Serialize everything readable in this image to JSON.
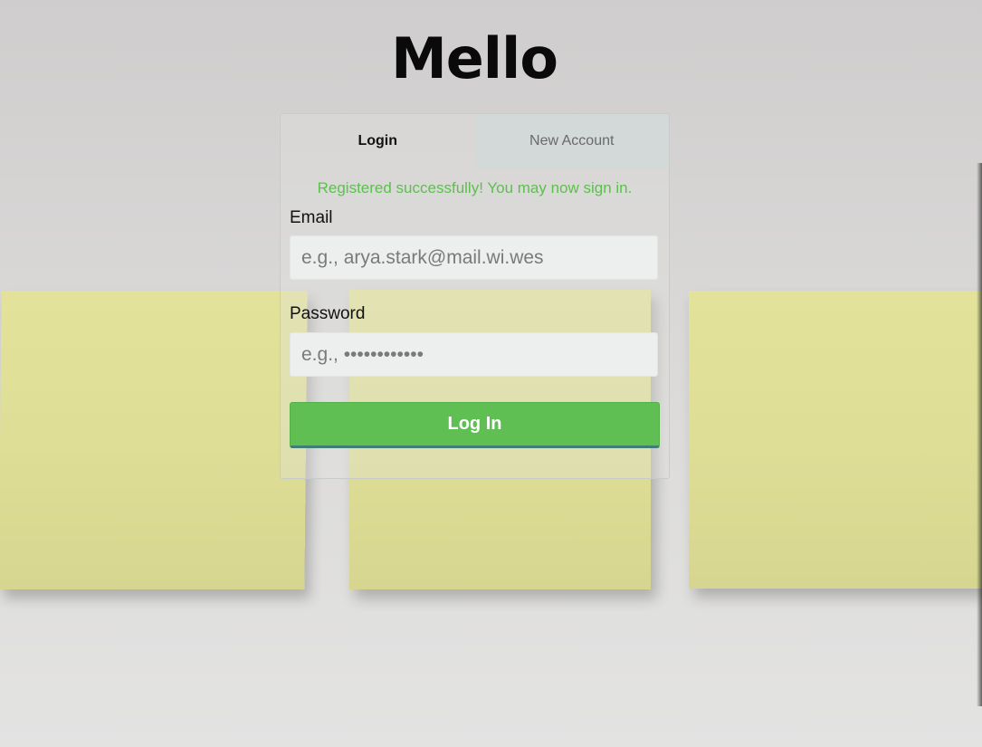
{
  "app": {
    "title": "Mello"
  },
  "tabs": [
    {
      "label": "Login",
      "active": true
    },
    {
      "label": "New Account",
      "active": false
    }
  ],
  "message": {
    "text": "Registered successfully! You may now sign in.",
    "color": "#5fbe50"
  },
  "form": {
    "email": {
      "label": "Email",
      "value": "",
      "placeholder": "e.g., arya.stark@mail.wi.wes"
    },
    "password": {
      "label": "Password",
      "value": "",
      "placeholder": "e.g., ••••••••••••"
    },
    "submit_label": "Log In"
  },
  "colors": {
    "primary_button": "#60bf52",
    "inactive_tab": "#d3d8d8",
    "note": "#dede97"
  }
}
